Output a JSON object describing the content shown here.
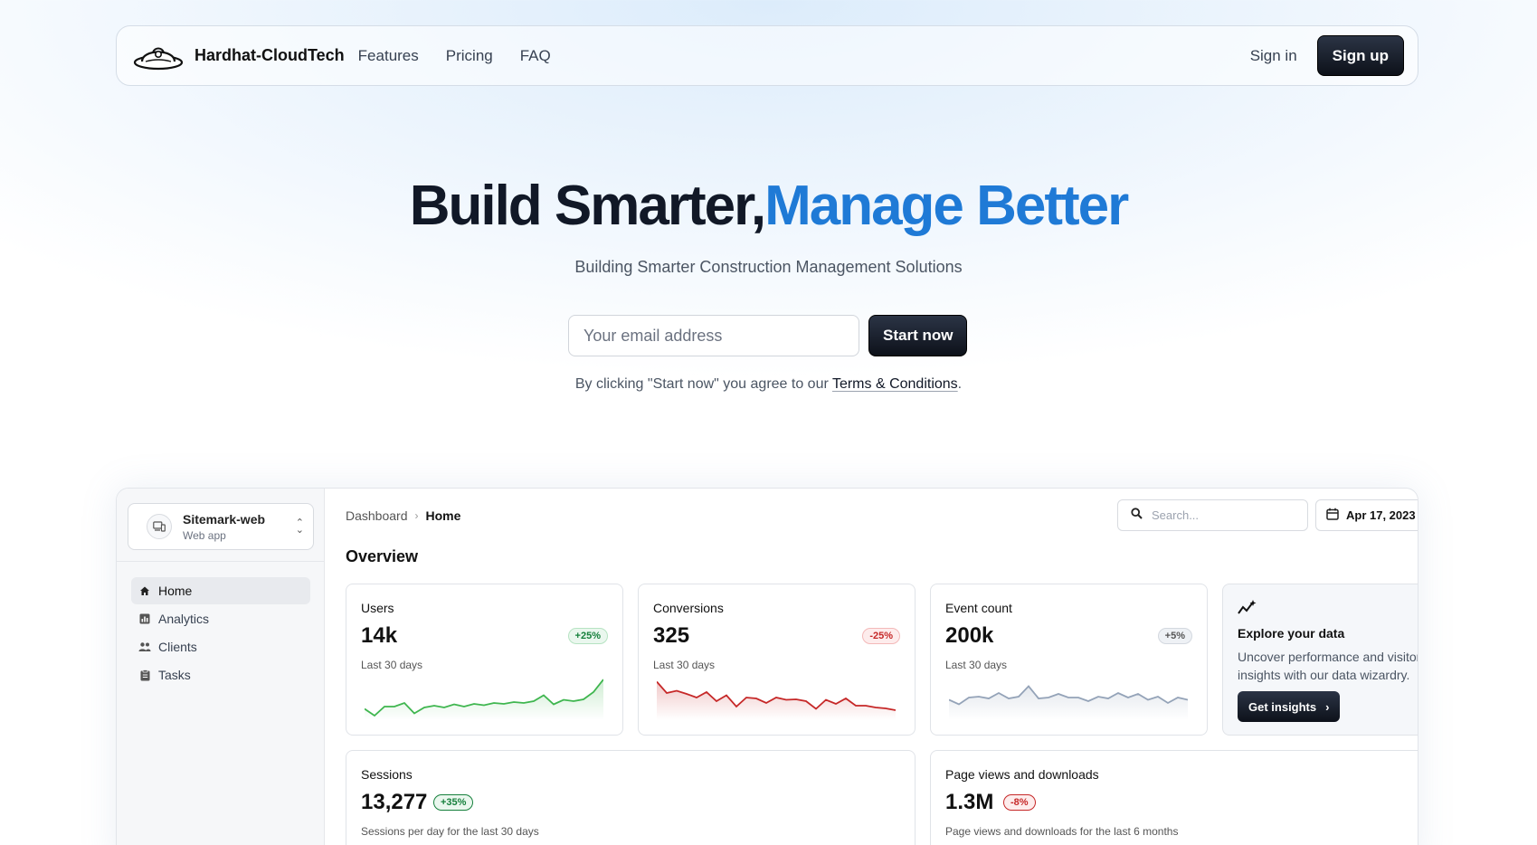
{
  "nav": {
    "brand": "Hardhat-CloudTech",
    "links": [
      "Features",
      "Pricing",
      "FAQ"
    ],
    "signin": "Sign in",
    "signup": "Sign up"
  },
  "hero": {
    "title_main": "Build Smarter,",
    "title_accent": "Manage Better",
    "subtitle": "Building Smarter Construction Management Solutions",
    "email_placeholder": "Your email address",
    "start_button": "Start now",
    "terms_prefix": "By clicking \"Start now\" you agree to our ",
    "terms_link": "Terms & Conditions",
    "terms_suffix": "."
  },
  "preview": {
    "site": {
      "name": "Sitemark-web",
      "type": "Web app"
    },
    "menu": [
      {
        "label": "Home",
        "icon": "home-icon",
        "active": true
      },
      {
        "label": "Analytics",
        "icon": "analytics-icon",
        "active": false
      },
      {
        "label": "Clients",
        "icon": "clients-icon",
        "active": false
      },
      {
        "label": "Tasks",
        "icon": "tasks-icon",
        "active": false
      }
    ],
    "breadcrumb": {
      "parent": "Dashboard",
      "current": "Home"
    },
    "search_placeholder": "Search...",
    "date": "Apr 17, 2023",
    "overview_title": "Overview",
    "cards": {
      "users": {
        "title": "Users",
        "value": "14k",
        "badge": "+25%",
        "sub": "Last 30 days"
      },
      "conversions": {
        "title": "Conversions",
        "value": "325",
        "badge": "-25%",
        "sub": "Last 30 days"
      },
      "events": {
        "title": "Event count",
        "value": "200k",
        "badge": "+5%",
        "sub": "Last 30 days"
      }
    },
    "explore": {
      "title": "Explore your data",
      "text": "Uncover performance and visitor insights with our data wizardry.",
      "button": "Get insights"
    },
    "sessions": {
      "title": "Sessions",
      "value": "13,277",
      "badge": "+35%",
      "sub": "Sessions per day for the last 30 days"
    },
    "pageviews": {
      "title": "Page views and downloads",
      "value": "1.3M",
      "badge": "-8%",
      "sub": "Page views and downloads for the last 6 months"
    }
  },
  "colors": {
    "accent": "#1f7ad6",
    "trend_up": "#3fb64f",
    "trend_down": "#c62828",
    "trend_neutral": "#94a3b8"
  }
}
